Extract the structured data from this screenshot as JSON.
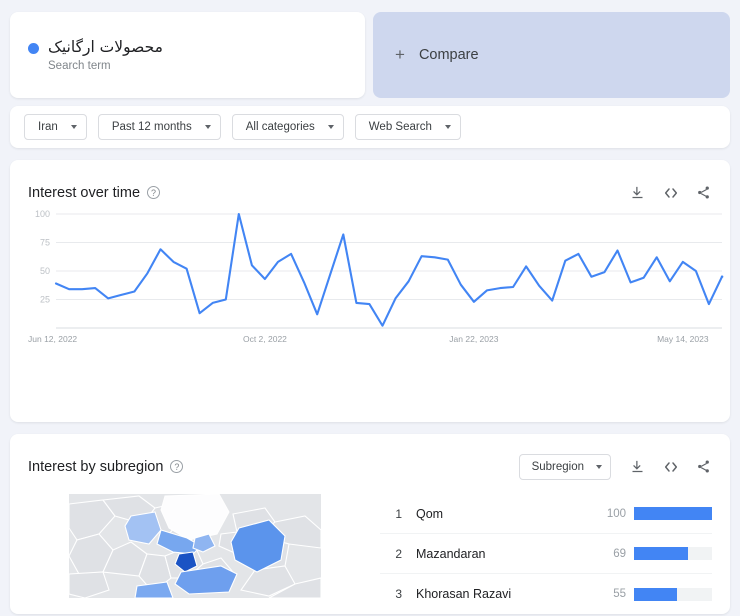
{
  "search_term": {
    "title": "محصولات ارگانیک",
    "subtitle": "Search term",
    "dot_color": "#4285f4"
  },
  "compare": {
    "label": "Compare",
    "plus_icon": "plus-icon"
  },
  "filters": [
    {
      "name": "region",
      "label": "Iran"
    },
    {
      "name": "time-range",
      "label": "Past 12 months"
    },
    {
      "name": "category",
      "label": "All categories"
    },
    {
      "name": "search-type",
      "label": "Web Search"
    }
  ],
  "interest_over_time": {
    "title": "Interest over time",
    "help_icon": "?",
    "actions": [
      {
        "name": "download-icon",
        "label": "Download"
      },
      {
        "name": "embed-icon",
        "label": "Embed"
      },
      {
        "name": "share-icon",
        "label": "Share"
      }
    ]
  },
  "interest_by_subregion": {
    "title": "Interest by subregion",
    "help_icon": "?",
    "dropdown": {
      "label": "Subregion"
    },
    "actions": [
      {
        "name": "download-icon",
        "label": "Download"
      },
      {
        "name": "embed-icon",
        "label": "Embed"
      },
      {
        "name": "share-icon",
        "label": "Share"
      }
    ],
    "rows": [
      {
        "rank": "1",
        "name": "Qom",
        "value": "100",
        "pct": 100
      },
      {
        "rank": "2",
        "name": "Mazandaran",
        "value": "69",
        "pct": 69
      },
      {
        "rank": "3",
        "name": "Khorasan Razavi",
        "value": "55",
        "pct": 55
      }
    ]
  },
  "chart_data": {
    "type": "line",
    "title": "Interest over time",
    "xlabel": "",
    "ylabel": "",
    "ylim": [
      0,
      100
    ],
    "yticks": [
      25,
      50,
      75,
      100
    ],
    "ytick_labels": [
      "25",
      "50",
      "75",
      "100"
    ],
    "xtick_labels": [
      "Jun 12, 2022",
      "Oct 2, 2022",
      "Jan 22, 2023",
      "May 14, 2023"
    ],
    "xtick_indices": [
      0,
      16,
      32,
      48
    ],
    "grid": true,
    "legend": "none",
    "line_color": "#4285f4",
    "partial_from_index": 51,
    "series": [
      {
        "name": "محصولات ارگانیک",
        "values": [
          39,
          34,
          34,
          35,
          26,
          29,
          32,
          48,
          69,
          58,
          52,
          13,
          22,
          25,
          100,
          55,
          43,
          58,
          65,
          40,
          12,
          47,
          82,
          22,
          21,
          2,
          26,
          41,
          63,
          62,
          60,
          38,
          23,
          33,
          35,
          36,
          54,
          37,
          24,
          59,
          65,
          45,
          49,
          68,
          40,
          44,
          62,
          41,
          58,
          50,
          21,
          45
        ]
      }
    ]
  }
}
